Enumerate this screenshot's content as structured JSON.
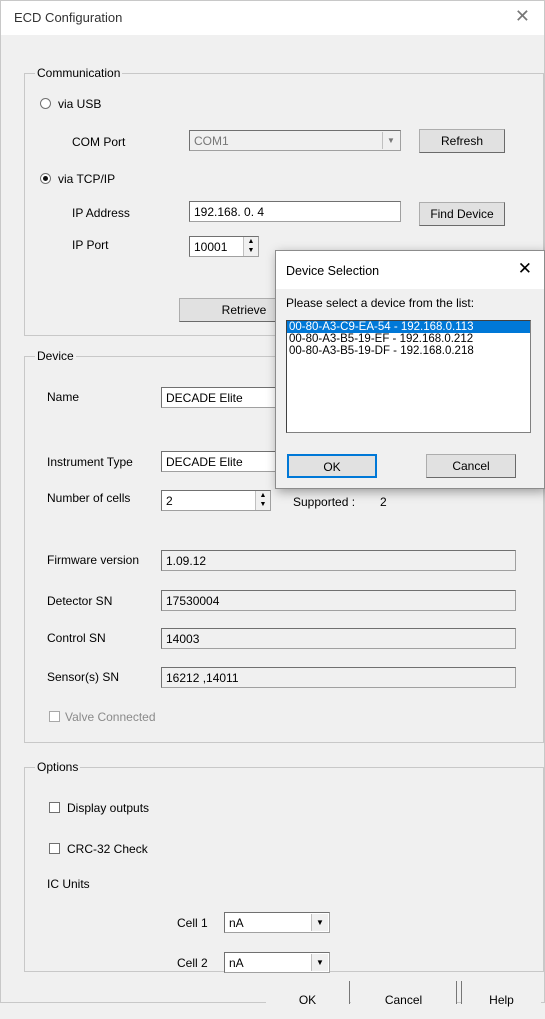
{
  "window": {
    "title": "ECD Configuration"
  },
  "communication": {
    "legend": "Communication",
    "via_usb_label": "via USB",
    "com_port_label": "COM Port",
    "com_port_value": "COM1",
    "refresh_label": "Refresh",
    "via_tcpip_label": "via TCP/IP",
    "ip_address_label": "IP Address",
    "ip_address_value": "192.168.  0.  4",
    "find_device_label": "Find Device",
    "ip_port_label": "IP Port",
    "ip_port_value": "10001",
    "retrieve_label": "Retrieve"
  },
  "device": {
    "legend": "Device",
    "name_label": "Name",
    "name_value": "DECADE Elite",
    "instrument_type_label": "Instrument Type",
    "instrument_type_value": "DECADE Elite",
    "cells_label": "Number of cells",
    "cells_value": "2",
    "supported_label": "Supported :",
    "supported_value": "2",
    "firmware_label": "Firmware version",
    "firmware_value": "1.09.12",
    "detector_sn_label": "Detector SN",
    "detector_sn_value": "17530004",
    "control_sn_label": "Control SN",
    "control_sn_value": "14003",
    "sensor_sn_label": "Sensor(s) SN",
    "sensor_sn_value": "16212 ,14011",
    "valve_label": "Valve Connected"
  },
  "options": {
    "legend": "Options",
    "display_outputs_label": "Display outputs",
    "crc_label": "CRC-32 Check",
    "ic_units_label": "IC Units",
    "cell1_label": "Cell 1",
    "cell1_value": "nA",
    "cell2_label": "Cell 2",
    "cell2_value": "nA"
  },
  "footer": {
    "ok_label": "OK",
    "cancel_label": "Cancel",
    "help_label": "Help"
  },
  "dialog": {
    "title": "Device Selection",
    "prompt": "Please select a device from the list:",
    "devices": [
      "00-80-A3-C9-EA-54 - 192.168.0.113",
      "00-80-A3-B5-19-EF - 192.168.0.212",
      "00-80-A3-B5-19-DF - 192.168.0.218"
    ],
    "ok_label": "OK",
    "cancel_label": "Cancel"
  }
}
